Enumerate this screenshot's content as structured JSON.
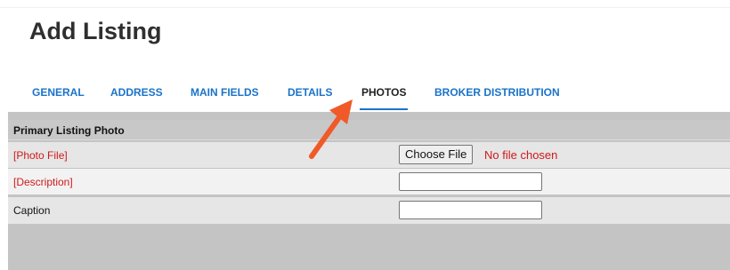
{
  "page": {
    "title": "Add Listing"
  },
  "tabs": [
    {
      "label": "GENERAL",
      "active": false
    },
    {
      "label": "ADDRESS",
      "active": false
    },
    {
      "label": "MAIN FIELDS",
      "active": false
    },
    {
      "label": "DETAILS",
      "active": false
    },
    {
      "label": "PHOTOS",
      "active": true
    },
    {
      "label": "BROKER DISTRIBUTION",
      "active": false
    }
  ],
  "section": {
    "header": "Primary Listing Photo",
    "rows": [
      {
        "label": "[Photo File]",
        "required": true,
        "button_label": "Choose File",
        "status": "No file chosen"
      },
      {
        "label": "[Description]",
        "required": true,
        "value": "",
        "placeholder": ""
      },
      {
        "label": "Caption",
        "required": false,
        "value": "",
        "placeholder": ""
      }
    ]
  },
  "annotation": {
    "icon": "arrow-pointing-icon",
    "color": "#f05a28"
  },
  "colors": {
    "tab_accent": "#1a73c9",
    "required_text": "#d0191b",
    "panel_bg": "#c4c4c4"
  }
}
